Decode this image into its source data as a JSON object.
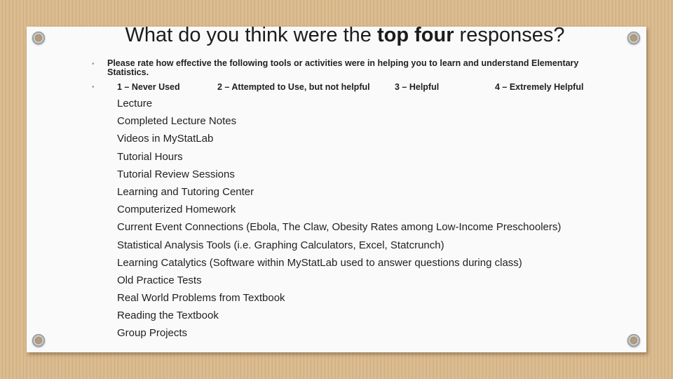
{
  "slide": {
    "title_pre": "What do you think were the ",
    "title_bold": "top four",
    "title_post": " responses?",
    "prompt": "Please rate how effective the following tools or activities were in helping you to learn and understand Elementary Statistics.",
    "scale": [
      "1 – Never Used",
      "2 – Attempted to Use, but not helpful",
      "3 – Helpful",
      "4 – Extremely Helpful"
    ],
    "items": [
      "Lecture",
      "Completed Lecture Notes",
      "Videos in MyStatLab",
      "Tutorial Hours",
      "Tutorial Review Sessions",
      "Learning and Tutoring Center",
      "Computerized Homework",
      "Current Event Connections (Ebola, The Claw, Obesity Rates among Low-Income Preschoolers)",
      "Statistical Analysis Tools (i.e. Graphing Calculators, Excel, Statcrunch)",
      "Learning Catalytics (Software within MyStatLab used to answer questions during class)",
      "Old Practice Tests",
      "Real World Problems from Textbook",
      "Reading the Textbook",
      "Group Projects"
    ],
    "bullet_glyph": "•"
  }
}
